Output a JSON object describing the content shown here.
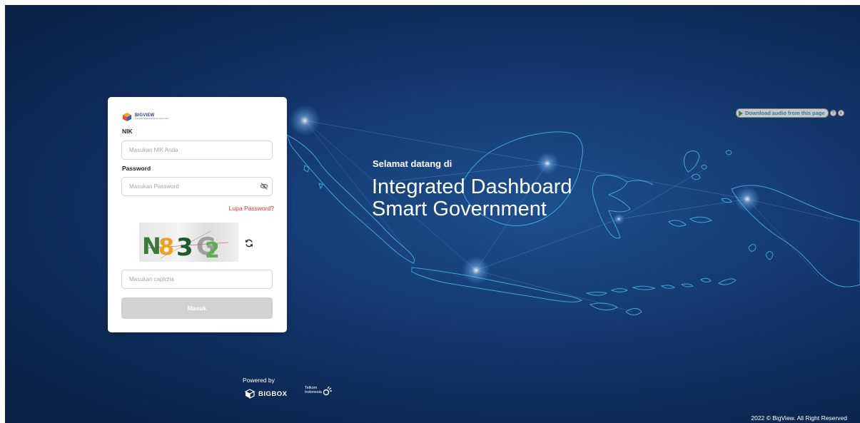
{
  "login": {
    "logo_title": "BIGVIEW",
    "logo_subtitle": "Integrated Dashboard Smart Government",
    "nik_label": "NIK",
    "nik_placeholder": "Masukan NIK Anda",
    "password_label": "Password",
    "password_placeholder": "Masukan Password",
    "forgot_password": "Lupa Password?",
    "captcha_text": "N83G2",
    "captcha_placeholder": "Masukan captcha",
    "submit_label": "Masuk"
  },
  "welcome": {
    "greeting": "Selamat datang di",
    "title_line1": "Integrated Dashboard",
    "title_line2": "Smart Government"
  },
  "footer": {
    "powered_by": "Powered by",
    "bigbox": "BIGBOX",
    "telkom_line1": "Telkom",
    "telkom_line2": "Indonesia",
    "copyright": "2022 © BigView. All Right Reserved"
  },
  "audio_widget": {
    "label": "Download audio from this page",
    "help": "?",
    "close": "x"
  },
  "icons": {
    "eye_off": "eye-off-icon",
    "refresh": "refresh-icon",
    "play": "play-icon"
  },
  "colors": {
    "background_dark": "#0a1f45",
    "background_light": "#1d4f8e",
    "forgot_link": "#e0322d",
    "button_disabled": "#d2d2d2"
  }
}
